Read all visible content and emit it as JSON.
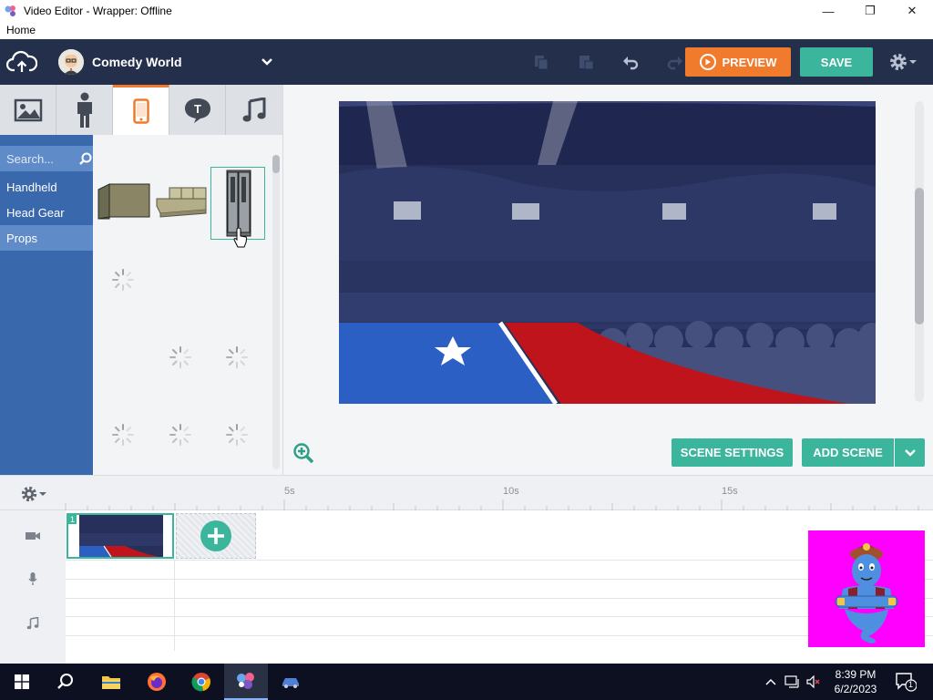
{
  "window": {
    "title": "Video Editor - Wrapper: Offline",
    "menu_home": "Home"
  },
  "topbar": {
    "theme_name": "Comedy World",
    "preview_label": "PREVIEW",
    "save_label": "SAVE"
  },
  "sidebar": {
    "search_placeholder": "Search...",
    "categories": [
      "Handheld",
      "Head Gear",
      "Props"
    ]
  },
  "stage": {
    "scene_settings_label": "SCENE SETTINGS",
    "add_scene_label": "ADD SCENE"
  },
  "timeline": {
    "ticks": [
      "5s",
      "10s",
      "15s"
    ],
    "scene_number": "1"
  },
  "taskbar": {
    "time": "8:39 PM",
    "date": "6/2/2023",
    "notifications": "1"
  },
  "colors": {
    "accent_orange": "#f07b2c",
    "accent_teal": "#3bb59b",
    "topbar_navy": "#232f4b",
    "sidebar_blue": "#3a68ad"
  }
}
